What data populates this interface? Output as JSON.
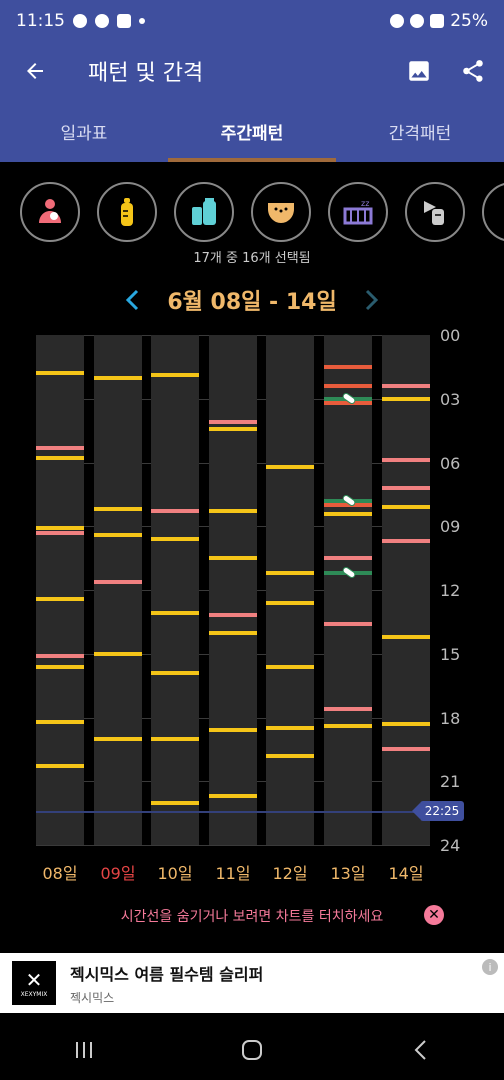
{
  "statusbar": {
    "time": "11:15",
    "battery": "25%"
  },
  "appbar": {
    "title": "패턴 및 간격"
  },
  "tabs": [
    {
      "label": "일과표",
      "active": false
    },
    {
      "label": "주간패턴",
      "active": true
    },
    {
      "label": "간격패턴",
      "active": false
    }
  ],
  "categories": [
    {
      "icon": "breastfeeding-icon",
      "color": "#f06b78"
    },
    {
      "icon": "bottle-icon",
      "color": "#f5c518"
    },
    {
      "icon": "formula-icon",
      "color": "#5fd0d6"
    },
    {
      "icon": "diaper-icon",
      "color": "#f0b86a"
    },
    {
      "icon": "sleep-crib-icon",
      "color": "#8c7ad6"
    },
    {
      "icon": "breast-pump-icon",
      "color": "#cccccc"
    },
    {
      "icon": "more-category-icon",
      "color": "#cccccc"
    }
  ],
  "selection_count": "17개 중 16개 선택됨",
  "week_range": "6월 08일 - 14일",
  "ticks": [
    "00",
    "03",
    "06",
    "09",
    "12",
    "15",
    "18",
    "21",
    "24"
  ],
  "now_time": "22:25",
  "days": [
    {
      "label": "08일",
      "today": false
    },
    {
      "label": "09일",
      "today": true
    },
    {
      "label": "10일",
      "today": false
    },
    {
      "label": "11일",
      "today": false
    },
    {
      "label": "12일",
      "today": false
    },
    {
      "label": "13일",
      "today": false
    },
    {
      "label": "14일",
      "today": false
    }
  ],
  "events": [
    [
      {
        "h": 1.8,
        "c": "y"
      },
      {
        "h": 5.3,
        "c": "p"
      },
      {
        "h": 5.8,
        "c": "y"
      },
      {
        "h": 9.1,
        "c": "y"
      },
      {
        "h": 9.3,
        "c": "p"
      },
      {
        "h": 12.4,
        "c": "y"
      },
      {
        "h": 15.1,
        "c": "p"
      },
      {
        "h": 15.6,
        "c": "y"
      },
      {
        "h": 18.2,
        "c": "y"
      },
      {
        "h": 20.3,
        "c": "y"
      }
    ],
    [
      {
        "h": 2.0,
        "c": "y"
      },
      {
        "h": 8.2,
        "c": "y"
      },
      {
        "h": 9.4,
        "c": "y"
      },
      {
        "h": 11.6,
        "c": "p"
      },
      {
        "h": 15.0,
        "c": "y"
      },
      {
        "h": 19.0,
        "c": "y"
      }
    ],
    [
      {
        "h": 1.9,
        "c": "y"
      },
      {
        "h": 8.3,
        "c": "p"
      },
      {
        "h": 9.6,
        "c": "y"
      },
      {
        "h": 13.1,
        "c": "y"
      },
      {
        "h": 15.9,
        "c": "y"
      },
      {
        "h": 19.0,
        "c": "y"
      },
      {
        "h": 22.0,
        "c": "y"
      }
    ],
    [
      {
        "h": 4.1,
        "c": "p"
      },
      {
        "h": 4.4,
        "c": "y"
      },
      {
        "h": 8.3,
        "c": "y"
      },
      {
        "h": 10.5,
        "c": "y"
      },
      {
        "h": 13.2,
        "c": "p"
      },
      {
        "h": 14.0,
        "c": "y"
      },
      {
        "h": 18.6,
        "c": "y"
      },
      {
        "h": 21.7,
        "c": "y"
      }
    ],
    [
      {
        "h": 6.2,
        "c": "y"
      },
      {
        "h": 11.2,
        "c": "y"
      },
      {
        "h": 12.6,
        "c": "y"
      },
      {
        "h": 15.6,
        "c": "y"
      },
      {
        "h": 18.5,
        "c": "y"
      },
      {
        "h": 19.8,
        "c": "y"
      }
    ],
    [
      {
        "h": 1.5,
        "c": "r"
      },
      {
        "h": 2.4,
        "c": "r"
      },
      {
        "h": 3.2,
        "c": "r"
      },
      {
        "h": 3.0,
        "c": "g",
        "pill": true
      },
      {
        "h": 8.0,
        "c": "r"
      },
      {
        "h": 8.4,
        "c": "y"
      },
      {
        "h": 7.8,
        "c": "g",
        "pill": true
      },
      {
        "h": 10.5,
        "c": "p"
      },
      {
        "h": 11.2,
        "c": "g",
        "pill": true
      },
      {
        "h": 13.6,
        "c": "p"
      },
      {
        "h": 17.6,
        "c": "p"
      },
      {
        "h": 18.4,
        "c": "y"
      }
    ],
    [
      {
        "h": 2.4,
        "c": "p"
      },
      {
        "h": 3.0,
        "c": "y"
      },
      {
        "h": 5.9,
        "c": "p"
      },
      {
        "h": 7.2,
        "c": "p"
      },
      {
        "h": 8.1,
        "c": "y"
      },
      {
        "h": 9.7,
        "c": "p"
      },
      {
        "h": 14.2,
        "c": "y"
      },
      {
        "h": 18.3,
        "c": "y"
      },
      {
        "h": 19.5,
        "c": "p"
      }
    ]
  ],
  "hint": "시간선을 숨기거나 보려면 차트를 터치하세요",
  "ad": {
    "title": "젝시믹스 여름 필수템 슬리퍼",
    "subtitle": "젝시믹스",
    "logo_text": "XEXYMIX",
    "info": "i"
  }
}
